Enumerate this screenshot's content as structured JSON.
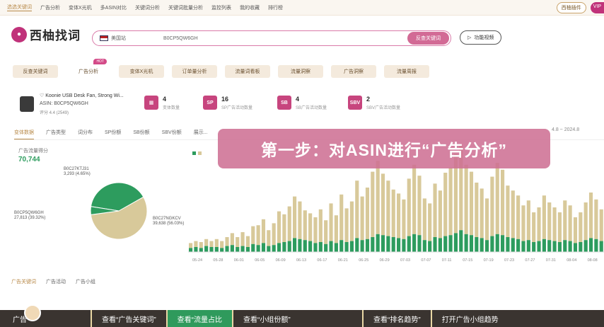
{
  "topnav": {
    "items": [
      "选选关键词",
      "广告分析",
      "变体X光机",
      "多ASIN对比",
      "关键词分析",
      "关键词批量分析",
      "监控列表",
      "我的收藏",
      "排行榜"
    ],
    "plugin_label": "西柚插件",
    "vip_label": "VIP"
  },
  "logo": {
    "name": "西柚找词"
  },
  "search": {
    "market": "美国站",
    "query": "B0CP5QW6GH",
    "button": "反查关键词"
  },
  "help_button": "功能视频",
  "tools": {
    "hot_badge": "HOT",
    "items": [
      "反查关键词",
      "广告分析",
      "变体X光机",
      "订单量分析",
      "流量词看板",
      "流量洞察",
      "广告洞察",
      "流量周报"
    ]
  },
  "product": {
    "title": "Koonie USB Desk Fan, Strong Wi...",
    "asin": "ASIN: B0CP5QW6GH",
    "meta": "评分 4.4 (2549)"
  },
  "stats": [
    {
      "icon": "grid-icon",
      "value": "4",
      "label": "变体数量"
    },
    {
      "icon": "sp-icon",
      "value": "16",
      "label": "SP广告活动数量"
    },
    {
      "icon": "sb-icon",
      "value": "4",
      "label": "SB广告活动数量"
    },
    {
      "icon": "sbv-icon",
      "value": "2",
      "label": "SBV广告活动数量"
    }
  ],
  "subtabs": [
    "变体数据",
    "广告类型",
    "词分布",
    "SP份额",
    "SB份额",
    "SBV份额",
    "展示..."
  ],
  "daterange": "4.8 ~ 2024.8",
  "left_metric": {
    "label": "广告流量得分",
    "value": "70,744"
  },
  "banner": "第一步：对ASIN进行“广告分析”",
  "bottom_tabs": [
    "广告关键词",
    "广告活动",
    "广告小组"
  ],
  "ticker": [
    "查看“广告关键词”",
    "查看“流量占比",
    "查看“小组份额”",
    "查看“排名趋势”",
    "打开广告小组趋势"
  ],
  "ticker_partial": "广告",
  "colors": {
    "accent": "#c0327a",
    "green": "#2d9c5e",
    "tan": "#d8c99a"
  },
  "chart_data": [
    {
      "type": "pie",
      "labels": [
        "B0CP5QW6GH",
        "B0C27NGKCV",
        "B0C27KTJ31"
      ],
      "values": [
        27813,
        39638,
        3293
      ],
      "display": [
        "27,813 (39.32%)",
        "39,638 (56.03%)",
        "3,293 (4.65%)"
      ]
    },
    {
      "type": "bar",
      "x_ticks": [
        "05-24",
        "05-28",
        "06-01",
        "06-05",
        "06-09",
        "06-13",
        "06-17",
        "06-21",
        "06-25",
        "06-29",
        "07-03",
        "07-07",
        "07-11",
        "07-15",
        "07-19",
        "07-23",
        "07-27",
        "07-31",
        "08-04",
        "08-08"
      ],
      "series": [
        {
          "values": [
            4,
            5,
            4,
            6,
            5,
            5,
            4,
            6,
            7,
            5,
            6,
            5,
            8,
            7,
            9,
            6,
            7,
            9,
            10,
            11,
            14,
            13,
            12,
            11,
            9,
            10,
            8,
            11,
            9,
            12,
            10,
            11,
            14,
            12,
            13,
            15,
            18,
            17,
            16,
            15,
            14,
            13,
            16,
            18,
            17,
            12,
            11,
            15,
            14,
            16,
            17,
            19,
            22,
            18,
            17,
            15,
            14,
            12,
            16,
            18,
            17,
            15,
            14,
            13,
            11,
            12,
            10,
            11,
            13,
            12,
            11,
            10,
            12,
            11,
            9,
            10,
            12,
            14,
            13,
            11
          ]
        },
        {
          "values": [
            5,
            6,
            6,
            7,
            6,
            8,
            7,
            9,
            12,
            10,
            14,
            11,
            18,
            20,
            24,
            16,
            22,
            32,
            28,
            35,
            42,
            38,
            30,
            28,
            26,
            33,
            24,
            38,
            28,
            46,
            34,
            40,
            58,
            44,
            52,
            66,
            74,
            62,
            56,
            48,
            45,
            40,
            58,
            70,
            60,
            42,
            38,
            54,
            48,
            64,
            68,
            80,
            86,
            70,
            64,
            55,
            50,
            42,
            60,
            72,
            66,
            52,
            48,
            44,
            36,
            40,
            30,
            34,
            44,
            38,
            34,
            30,
            40,
            36,
            26,
            30,
            38,
            46,
            40,
            32
          ]
        }
      ]
    }
  ]
}
